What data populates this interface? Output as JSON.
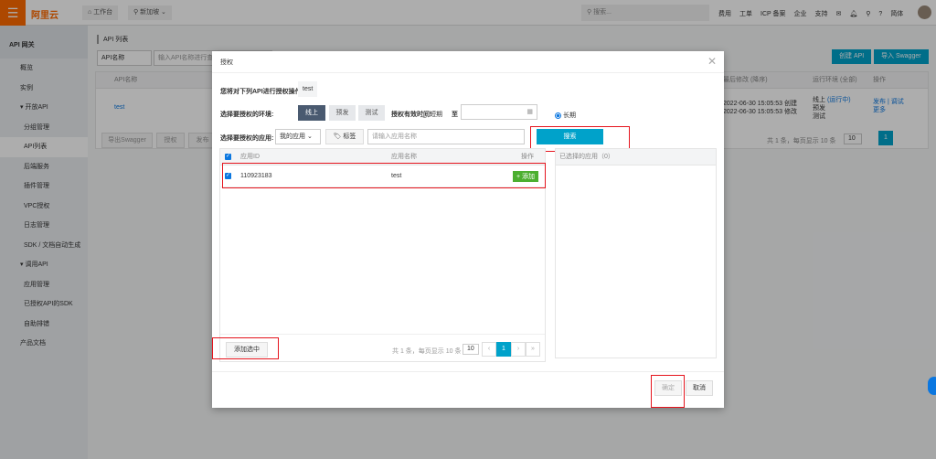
{
  "topbar": {
    "logo": "阿里云",
    "workbench": "工作台",
    "region": "新加坡",
    "search_placeholder": "搜索...",
    "links": [
      "费用",
      "工单",
      "ICP 备案",
      "企业",
      "支持"
    ],
    "lang": "简体"
  },
  "sidebar": {
    "title": "API 网关",
    "items": [
      {
        "label": "概览",
        "level": 0
      },
      {
        "label": "实例",
        "level": 0
      },
      {
        "label": "▾ 开放API",
        "level": 0
      },
      {
        "label": "分组管理",
        "level": 1
      },
      {
        "label": "API列表",
        "level": 1,
        "active": true
      },
      {
        "label": "后端服务",
        "level": 1
      },
      {
        "label": "插件管理",
        "level": 1
      },
      {
        "label": "VPC授权",
        "level": 1
      },
      {
        "label": "日志管理",
        "level": 1
      },
      {
        "label": "SDK / 文档自动生成",
        "level": 1
      },
      {
        "label": "▾ 调用API",
        "level": 0
      },
      {
        "label": "应用管理",
        "level": 1
      },
      {
        "label": "已授权API的SDK",
        "level": 1
      },
      {
        "label": "自助排错",
        "level": 1
      },
      {
        "label": "产品文档",
        "level": 0
      }
    ]
  },
  "main": {
    "title": "API 列表",
    "filter_select": "API名称",
    "filter_placeholder": "输入API名称进行查询",
    "create_api": "创建 API",
    "import_swagger": "导入 Swagger",
    "col_name": "API名称",
    "col_modified": "最后修改 (降序)",
    "col_env": "运行环境 (全部)",
    "col_ops": "操作",
    "row": {
      "name": "test",
      "created": "2022-06-30 15:05:53 创建",
      "modified": "2022-06-30 15:05:53 修改",
      "envs": [
        "线上",
        "预发",
        "测试"
      ],
      "running": "(运行中)",
      "ops": [
        "发布",
        "调试",
        "更多"
      ]
    },
    "bottom_buttons": [
      "导出Swagger",
      "授权",
      "发布"
    ],
    "pager_text": "共 1 条，每页显示 10 条",
    "page_size": "10",
    "page": "1"
  },
  "modal": {
    "title": "授权",
    "api_label": "您将对下列API进行授权操作:",
    "api_name": "test",
    "env_label": "选择要授权的环境:",
    "envs": [
      {
        "label": "线上",
        "selected": true
      },
      {
        "label": "预发",
        "selected": false
      },
      {
        "label": "测试",
        "selected": false
      }
    ],
    "valid_label": "授权有效时间:",
    "short_term": "短期",
    "to": "至",
    "long_term": "长期",
    "long_term_selected": true,
    "app_label": "选择要授权的应用:",
    "app_select": "我的应用",
    "tag_button": "标签",
    "app_placeholder": "请输入应用名称",
    "search_button": "搜索",
    "table": {
      "col_id": "应用ID",
      "col_name": "应用名称",
      "col_op": "操作",
      "rows": [
        {
          "id": "110923183",
          "name": "test",
          "action": "+ 添加",
          "checked": true
        }
      ]
    },
    "selected_title": "已选择的应用（0）",
    "add_selected": "添加选中",
    "pager_text": "共 1 条，每页显示 10 条",
    "page_size": "10",
    "page": "1",
    "confirm": "确定",
    "cancel": "取消"
  },
  "colors": {
    "accent": "#00a2ca",
    "brand": "#ff6a00",
    "highlight": "#e5141d",
    "add_green": "#4caf30"
  }
}
